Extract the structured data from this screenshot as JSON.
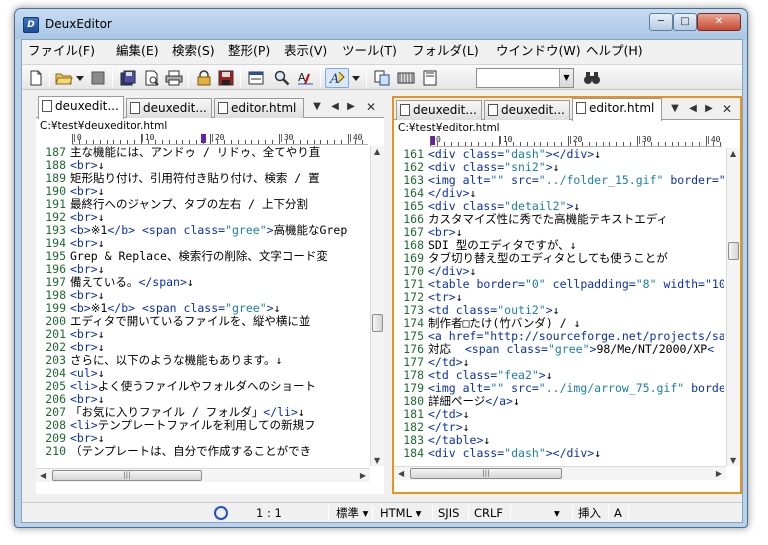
{
  "window": {
    "title": "DeuxEditor",
    "app_icon_glyph": "D",
    "min_glyph": "─",
    "max_glyph": "□",
    "close_glyph": "✕"
  },
  "menu": [
    "ファイル(F)",
    "編集(E)",
    "検索(S)",
    "整形(P)",
    "表示(V)",
    "ツール(T)",
    "フォルダ(L)",
    "ウインドウ(W)",
    "ヘルプ(H)"
  ],
  "toolbar": {
    "icons": [
      "new-file-icon",
      "open-folder-icon",
      "dropdown-arrow-icon",
      "stop-icon",
      "save-all-icon",
      "print-preview-icon",
      "print-icon",
      "lock-icon",
      "save-close-icon",
      "window-icon",
      "search-icon",
      "spellcheck-icon",
      "highlight-icon",
      "copy-icon",
      "film-icon",
      "bookmark-icon",
      "binoculars-icon"
    ],
    "combo_value": "",
    "combo_arrow": "▼"
  },
  "left_pane": {
    "tabs": [
      {
        "label": "deuxedit...",
        "active": true
      },
      {
        "label": "deuxedit...",
        "active": false
      },
      {
        "label": "editor.html",
        "active": false
      }
    ],
    "tab_controls": [
      "▼",
      "◀",
      "▶",
      "✕"
    ],
    "path": "C:¥test¥deuxeditor.html",
    "ruler_labels": [
      "|0",
      "|10",
      "|20",
      "|30",
      "|40"
    ],
    "lines": [
      {
        "n": "187",
        "t": "主な機能には、アンドゥ / リドゥ、全てやり直"
      },
      {
        "n": "188",
        "t": "<br>↓"
      },
      {
        "n": "189",
        "t": "矩形貼り付け、引用符付き貼り付け、検索 / 置"
      },
      {
        "n": "190",
        "t": "<br>↓"
      },
      {
        "n": "191",
        "t": "最終行へのジャンプ、タブの左右 / 上下分割"
      },
      {
        "n": "192",
        "t": "<br>↓"
      },
      {
        "n": "193",
        "t": "<b>※1</b> <span class=\"gree\">高機能なGrep"
      },
      {
        "n": "194",
        "t": "<br>↓"
      },
      {
        "n": "195",
        "t": "Grep & Replace、検索行の削除、文字コード変"
      },
      {
        "n": "196",
        "t": "<br>↓"
      },
      {
        "n": "197",
        "t": "備えている。</span>↓"
      },
      {
        "n": "198",
        "t": "<br>↓"
      },
      {
        "n": "199",
        "t": "<b>※1</b> <span class=\"gree\">↓"
      },
      {
        "n": "200",
        "t": "エディタで開いているファイルを、縦や横に並"
      },
      {
        "n": "201",
        "t": "<br>↓"
      },
      {
        "n": "202",
        "t": "<br>↓"
      },
      {
        "n": "203",
        "t": "さらに、以下のような機能もあります。↓"
      },
      {
        "n": "204",
        "t": "<ul>↓"
      },
      {
        "n": "205",
        "t": "<li>よく使うファイルやフォルダへのショート"
      },
      {
        "n": "206",
        "t": "<br>↓"
      },
      {
        "n": "207",
        "t": "「お気に入りファイル / フォルダ」</li>↓"
      },
      {
        "n": "208",
        "t": "<li>テンプレートファイルを利用しての新規フ"
      },
      {
        "n": "209",
        "t": "<br>↓"
      },
      {
        "n": "210",
        "t": "（テンプレートは、自分で作成することができ"
      }
    ]
  },
  "right_pane": {
    "tabs": [
      {
        "label": "deuxedit...",
        "active": false
      },
      {
        "label": "deuxedit...",
        "active": false
      },
      {
        "label": "editor.html",
        "active": true
      }
    ],
    "tab_controls": [
      "▼",
      "◀",
      "▶",
      "✕"
    ],
    "path": "C:¥test¥editor.html",
    "ruler_labels": [
      "0",
      "|10",
      "|20",
      "|30",
      "|40"
    ],
    "lines": [
      {
        "n": "161",
        "t": "<div class=\"dash\"></div>↓"
      },
      {
        "n": "162",
        "t": "<div class=\"sni2\">↓"
      },
      {
        "n": "163",
        "t": "<img alt=\"\" src=\"../folder_15.gif\" border=\""
      },
      {
        "n": "164",
        "t": "</div>↓"
      },
      {
        "n": "165",
        "t": "<div class=\"detail2\">↓"
      },
      {
        "n": "166",
        "t": "カスタマイズ性に秀でた高機能テキストエディ"
      },
      {
        "n": "167",
        "t": "<br>↓"
      },
      {
        "n": "168",
        "t": "SDI 型のエディタですが、↓"
      },
      {
        "n": "169",
        "t": "タブ切り替え型のエディタとしても使うことが"
      },
      {
        "n": "170",
        "t": "</div>↓"
      },
      {
        "n": "171",
        "t": "<table border=\"0\" cellpadding=\"8\" width=\"10"
      },
      {
        "n": "172",
        "t": "<tr>↓"
      },
      {
        "n": "173",
        "t": "<td class=\"outi2\">↓"
      },
      {
        "n": "174",
        "t": "制作者□たけ(竹バンダ) / ↓"
      },
      {
        "n": "175",
        "t": "<a href=\"http://sourceforge.net/projects/sa"
      },
      {
        "n": "176",
        "t": "対応  <span class=\"gree\">98/Me/NT/2000/XP<"
      },
      {
        "n": "177",
        "t": "</td>↓"
      },
      {
        "n": "178",
        "t": "<td class=\"fea2\">↓"
      },
      {
        "n": "179",
        "t": "<img alt=\"\" src=\"../img/arrow_75.gif\" borde"
      },
      {
        "n": "180",
        "t": "詳細ページ</a>↓"
      },
      {
        "n": "181",
        "t": "</td>↓"
      },
      {
        "n": "182",
        "t": "</tr>↓"
      },
      {
        "n": "183",
        "t": "</table>↓"
      },
      {
        "n": "184",
        "t": "<div class=\"dash\"></div>↓"
      }
    ]
  },
  "scroll": {
    "up": "▲",
    "down": "▼",
    "left": "◀",
    "right": "▶",
    "grip": "|||"
  },
  "status": {
    "position": "1 : 1",
    "mode": "標準",
    "syntax": "HTML",
    "encoding": "SJIS",
    "newline": "CRLF",
    "insert": "挿入",
    "ime": "A",
    "arrow": "▾"
  },
  "colors": {
    "active_pane_border": "#e8931f",
    "line_number": "#1d6b2e",
    "tag": "#0a2fb3",
    "ruler_cursor": "#6a1fa6"
  }
}
